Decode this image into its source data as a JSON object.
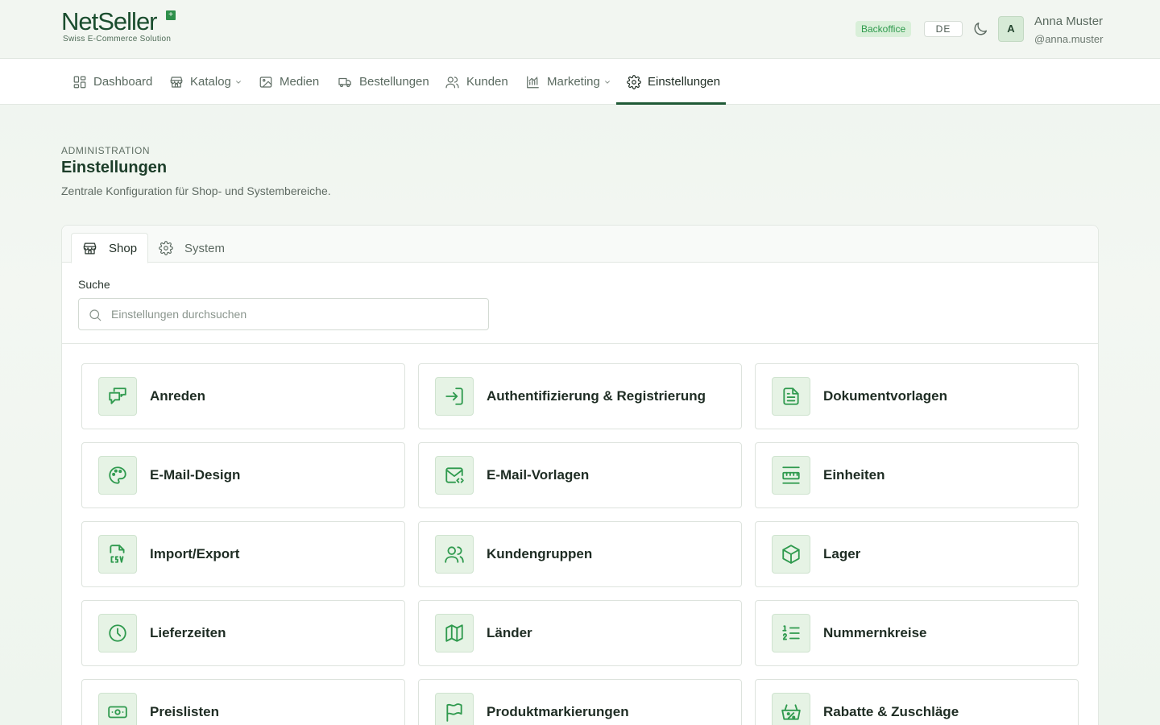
{
  "brand": {
    "name_part1": "Net",
    "name_part2": "Seller",
    "tagline": "Swiss E-Commerce Solution"
  },
  "header": {
    "badge": "Backoffice",
    "language": "DE",
    "avatar_initial": "A",
    "user_name": "Anna Muster",
    "user_handle": "@anna.muster"
  },
  "nav": {
    "items": [
      {
        "label": "Dashboard",
        "icon": "dashboard-icon"
      },
      {
        "label": "Katalog",
        "icon": "store-icon",
        "has_dropdown": true
      },
      {
        "label": "Medien",
        "icon": "image-icon"
      },
      {
        "label": "Bestellungen",
        "icon": "truck-icon"
      },
      {
        "label": "Kunden",
        "icon": "users-icon"
      },
      {
        "label": "Marketing",
        "icon": "chart-icon",
        "has_dropdown": true
      },
      {
        "label": "Einstellungen",
        "icon": "gear-icon",
        "active": true
      }
    ]
  },
  "page": {
    "eyebrow": "ADMINISTRATION",
    "title": "Einstellungen",
    "subtitle": "Zentrale Konfiguration für Shop- und Systembereiche."
  },
  "tabs": [
    {
      "label": "Shop",
      "icon": "store-icon",
      "active": true
    },
    {
      "label": "System",
      "icon": "gear-icon",
      "active": false
    }
  ],
  "search": {
    "label": "Suche",
    "placeholder": "Einstellungen durchsuchen",
    "value": ""
  },
  "settings": [
    {
      "label": "Anreden",
      "icon": "chat-bubbles-icon"
    },
    {
      "label": "Authentifizierung & Registrierung",
      "icon": "login-icon"
    },
    {
      "label": "Dokumentvorlagen",
      "icon": "document-icon"
    },
    {
      "label": "E-Mail-Design",
      "icon": "palette-icon"
    },
    {
      "label": "E-Mail-Vorlagen",
      "icon": "mail-code-icon"
    },
    {
      "label": "Einheiten",
      "icon": "ruler-icon"
    },
    {
      "label": "Import/Export",
      "icon": "csv-file-icon"
    },
    {
      "label": "Kundengruppen",
      "icon": "users-icon"
    },
    {
      "label": "Lager",
      "icon": "box-icon"
    },
    {
      "label": "Lieferzeiten",
      "icon": "clock-icon"
    },
    {
      "label": "Länder",
      "icon": "map-icon"
    },
    {
      "label": "Nummernkreise",
      "icon": "numbered-list-icon"
    },
    {
      "label": "Preislisten",
      "icon": "banknote-icon"
    },
    {
      "label": "Produktmarkierungen",
      "icon": "flag-icon"
    },
    {
      "label": "Rabatte & Zuschläge",
      "icon": "discount-basket-icon"
    }
  ],
  "colors": {
    "accent": "#2f9a4e",
    "brand_dark": "#1a4d2e",
    "tile_icon_bg": "#e6f3e5"
  }
}
